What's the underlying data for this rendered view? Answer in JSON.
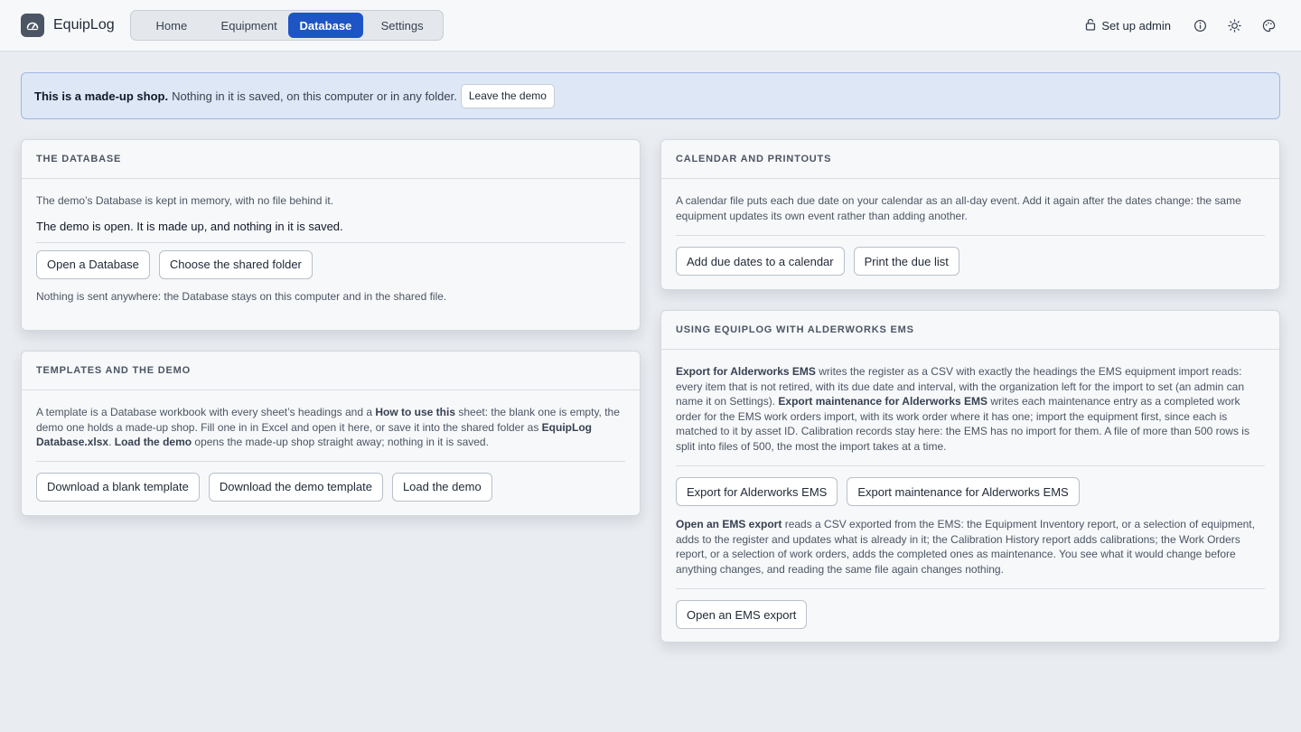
{
  "app": {
    "name": "EquipLog"
  },
  "nav": {
    "tabs": [
      {
        "label": "Home"
      },
      {
        "label": "Equipment"
      },
      {
        "label": "Database"
      },
      {
        "label": "Settings"
      }
    ],
    "active": "Database"
  },
  "header": {
    "admin_label": "Set up admin"
  },
  "banner": {
    "bold": "This is a made-up shop.",
    "text": "Nothing in it is saved, on this computer or in any folder.",
    "button": "Leave the demo"
  },
  "database_card": {
    "title": "THE DATABASE",
    "desc": "The demo’s Database is kept in memory, with no file behind it.",
    "status": "The demo is open. It is made up, and nothing in it is saved.",
    "btn_open": "Open a Database",
    "btn_folder": "Choose the shared folder",
    "foot": "Nothing is sent anywhere: the Database stays on this computer and in the shared file."
  },
  "templates_card": {
    "title": "TEMPLATES AND THE DEMO",
    "p1": "A template is a Database workbook with every sheet’s headings and a ",
    "b1": "How to use this",
    "p2": " sheet: the blank one is empty, the demo one holds a made-up shop. Fill one in in Excel and open it here, or save it into the shared folder as ",
    "b2": "EquipLog Database.xlsx",
    "p3": ". ",
    "b3": "Load the demo",
    "p4": " opens the made-up shop straight away; nothing in it is saved.",
    "btn_blank": "Download a blank template",
    "btn_demo_tpl": "Download the demo template",
    "btn_load": "Load the demo"
  },
  "calendar_card": {
    "title": "CALENDAR AND PRINTOUTS",
    "desc": "A calendar file puts each due date on your calendar as an all-day event. Add it again after the dates change: the same equipment updates its own event rather than adding another.",
    "btn_cal": "Add due dates to a calendar",
    "btn_print": "Print the due list"
  },
  "ems_card": {
    "title": "USING EQUIPLOG WITH ALDERWORKS EMS",
    "b1": "Export for Alderworks EMS",
    "p1": " writes the register as a CSV with exactly the headings the EMS equipment import reads: every item that is not retired, with its due date and interval, with the organization left for the import to set (an admin can name it on Settings). ",
    "b2": "Export maintenance for Alderworks EMS",
    "p2": " writes each maintenance entry as a completed work order for the EMS work orders import, with its work order where it has one; import the equipment first, since each is matched to it by asset ID. Calibration records stay here: the EMS has no import for them. A file of more than 500 rows is split into files of 500, the most the import takes at a time.",
    "btn_export": "Export for Alderworks EMS",
    "btn_export_maint": "Export maintenance for Alderworks EMS",
    "b3": "Open an EMS export",
    "p3": " reads a CSV exported from the EMS: the Equipment Inventory report, or a selection of equipment, adds to the register and updates what is already in it; the Calibration History report adds calibrations; the Work Orders report, or a selection of work orders, adds the completed ones as maintenance. You see what it would change before anything changes, and reading the same file again changes nothing.",
    "btn_open_export": "Open an EMS export"
  }
}
